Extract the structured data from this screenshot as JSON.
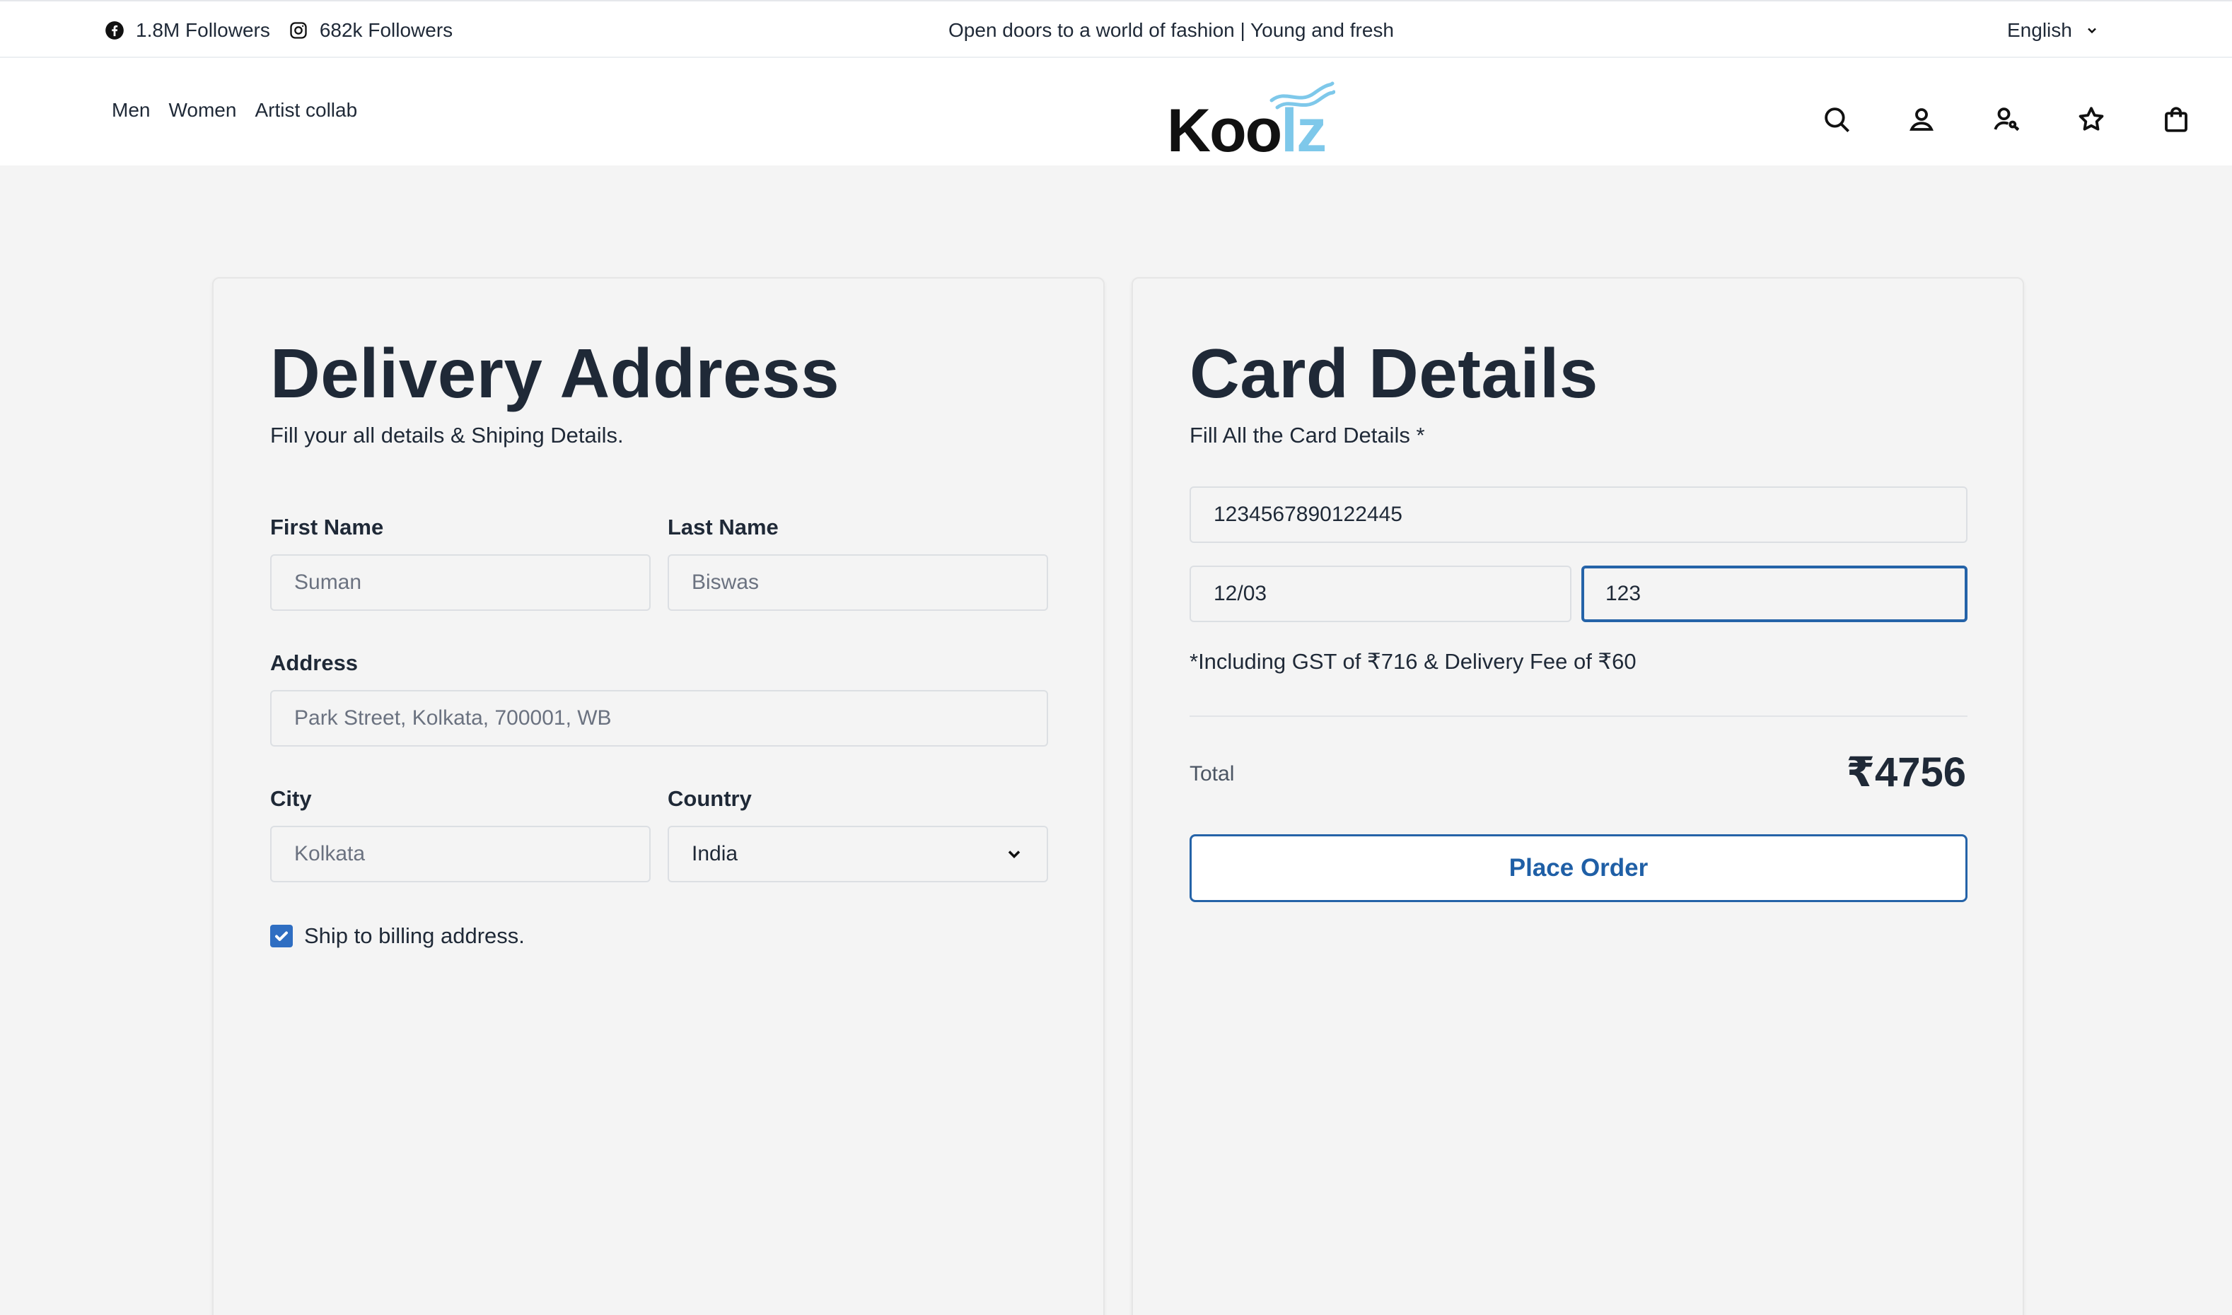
{
  "topbar": {
    "facebook_followers": "1.8M Followers",
    "instagram_followers": "682k Followers",
    "tagline": "Open doors to a world of fashion | Young and fresh",
    "language": "English"
  },
  "header": {
    "nav": [
      "Men",
      "Women",
      "Artist collab"
    ],
    "logo_text_main": "Koo",
    "logo_text_accent": "lz"
  },
  "delivery": {
    "title": "Delivery Address",
    "subtitle": "Fill your all details & Shiping Details.",
    "first_name_label": "First Name",
    "first_name_placeholder": "Suman",
    "last_name_label": "Last Name",
    "last_name_placeholder": "Biswas",
    "address_label": "Address",
    "address_placeholder": "Park Street, Kolkata, 700001, WB",
    "city_label": "City",
    "city_placeholder": "Kolkata",
    "country_label": "Country",
    "country_value": "India",
    "ship_checkbox_label": "Ship to billing address.",
    "ship_checked": true
  },
  "card": {
    "title": "Card Details",
    "subtitle": "Fill All the Card Details *",
    "card_number": "1234567890122445",
    "expiry": "12/03",
    "cvv": "123",
    "note": "*Including GST of ₹716 & Delivery Fee of ₹60",
    "total_label": "Total",
    "total_value": "₹4756",
    "button_label": "Place Order"
  },
  "colors": {
    "accent_blue": "#2563a8",
    "logo_accent": "#7ec8ea",
    "checkbox": "#2f6ec2"
  }
}
